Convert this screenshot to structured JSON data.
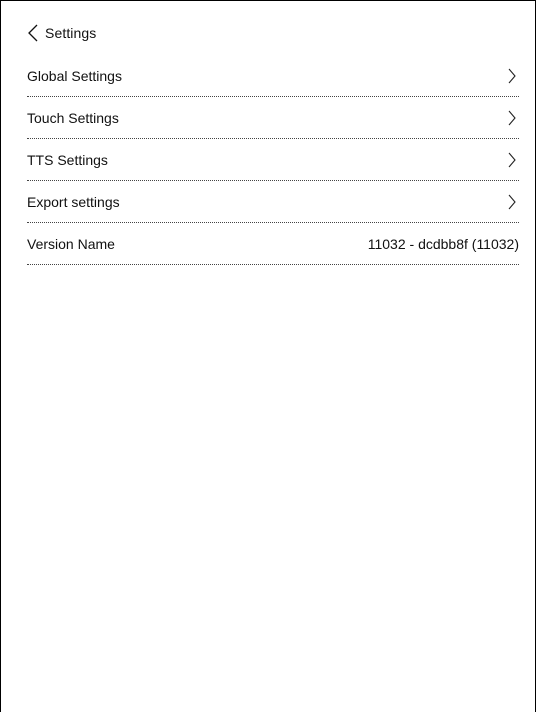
{
  "header": {
    "back_label": "Settings"
  },
  "rows": [
    {
      "label": "Global Settings",
      "icon": "chevron-right-icon"
    },
    {
      "label": "Touch Settings",
      "icon": "chevron-right-icon"
    },
    {
      "label": "TTS Settings",
      "icon": "chevron-right-icon"
    },
    {
      "label": "Export settings",
      "icon": "chevron-right-icon"
    }
  ],
  "version": {
    "label": "Version Name",
    "value": "11032 - dcdbb8f (11032)"
  }
}
